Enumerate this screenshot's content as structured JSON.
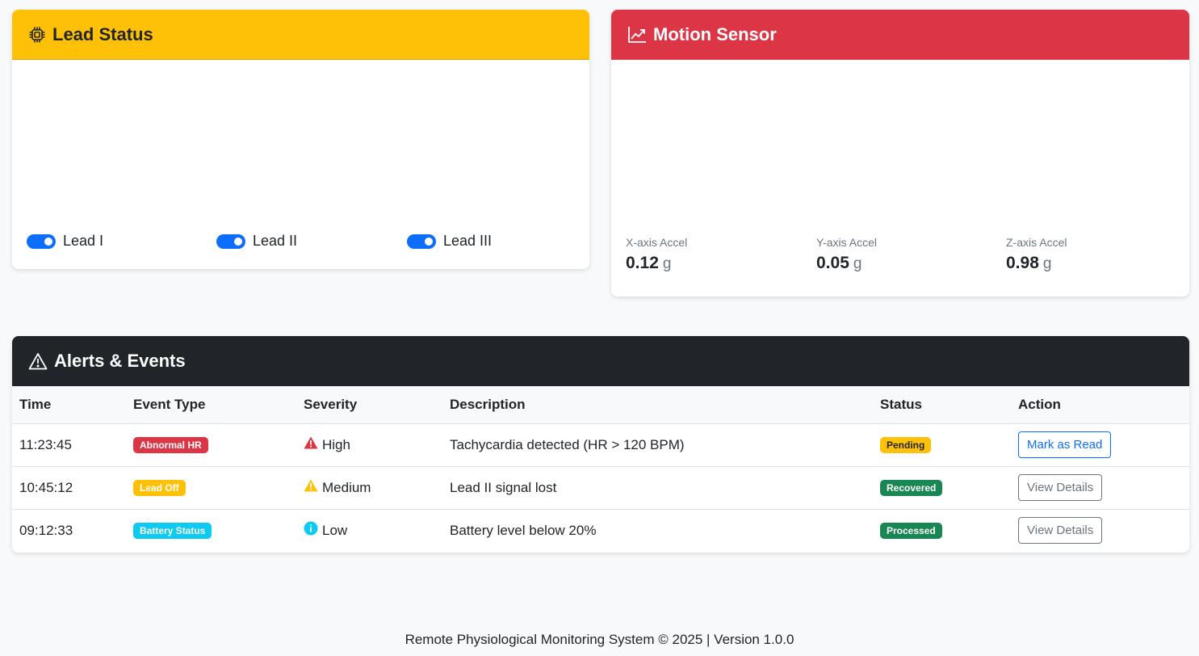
{
  "lead_status": {
    "title": "Lead Status",
    "leads": [
      {
        "label": "Lead I",
        "enabled": true
      },
      {
        "label": "Lead II",
        "enabled": true
      },
      {
        "label": "Lead III",
        "enabled": true
      }
    ]
  },
  "motion_sensor": {
    "title": "Motion Sensor",
    "axes": [
      {
        "label": "X-axis Accel",
        "value": "0.12",
        "unit": "g"
      },
      {
        "label": "Y-axis Accel",
        "value": "0.05",
        "unit": "g"
      },
      {
        "label": "Z-axis Accel",
        "value": "0.98",
        "unit": "g"
      }
    ]
  },
  "alerts": {
    "title": "Alerts & Events",
    "columns": [
      "Time",
      "Event Type",
      "Severity",
      "Description",
      "Status",
      "Action"
    ],
    "rows": [
      {
        "time": "11:23:45",
        "event_type": "Abnormal HR",
        "severity": "High",
        "description": "Tachycardia detected (HR > 120 BPM)",
        "status": "Pending",
        "action": "Mark as Read"
      },
      {
        "time": "10:45:12",
        "event_type": "Lead Off",
        "severity": "Medium",
        "description": "Lead II signal lost",
        "status": "Recovered",
        "action": "View Details"
      },
      {
        "time": "09:12:33",
        "event_type": "Battery Status",
        "severity": "Low",
        "description": "Battery level below 20%",
        "status": "Processed",
        "action": "View Details"
      }
    ]
  },
  "footer": {
    "text": "Remote Physiological Monitoring System © 2025 | Version 1.0.0"
  },
  "colors": {
    "warning": "#ffc107",
    "danger": "#dc3545",
    "dark": "#212529",
    "primary": "#0d6efd",
    "info": "#0dcaf0",
    "success": "#198754"
  }
}
